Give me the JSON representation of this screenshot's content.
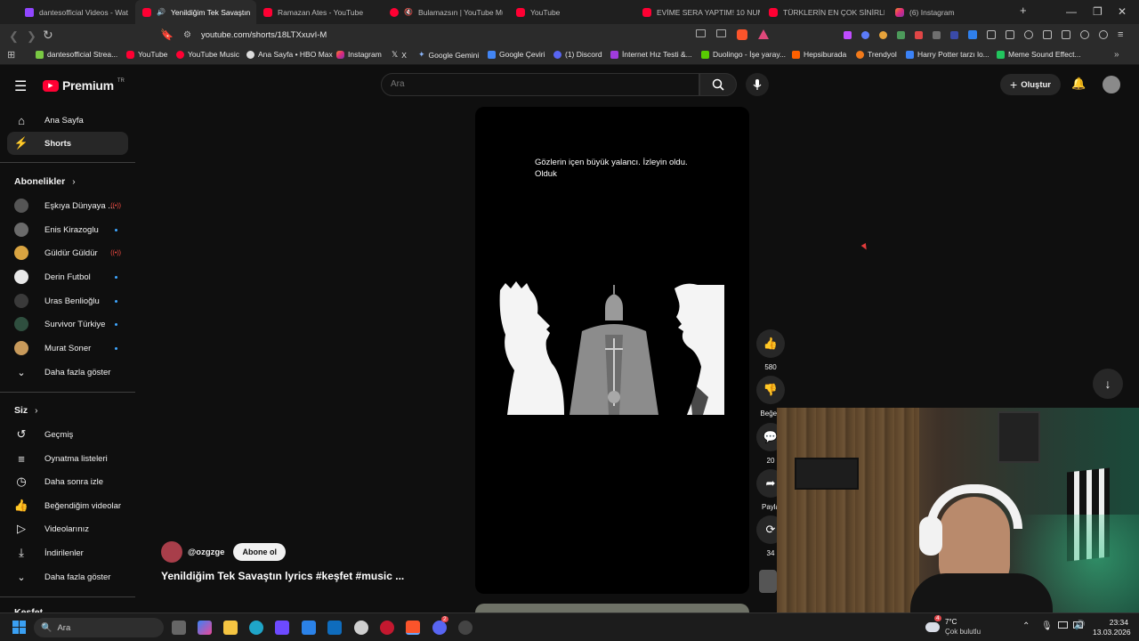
{
  "browser": {
    "tabs": [
      {
        "title": "dantesofficial Videos - Wat",
        "icon": "twitch-icon",
        "active": false
      },
      {
        "title": "Yenildiğim Tek Savaştın",
        "icon": "youtube-icon",
        "active": true
      },
      {
        "title": "Ramazan Ates - YouTube",
        "icon": "youtube-icon",
        "active": false
      },
      {
        "title": "Bulamazsın | YouTube Mu",
        "icon": "youtube-music-icon",
        "active": false
      },
      {
        "title": "YouTube",
        "icon": "youtube-icon",
        "active": false
      },
      {
        "title": "EVİME SERA YAPTIM! 10 NUM",
        "icon": "youtube-icon",
        "active": false
      },
      {
        "title": "TÜRKLERİN EN ÇOK SİNİRLENI",
        "icon": "youtube-icon",
        "active": false
      },
      {
        "title": "(6) Instagram",
        "icon": "instagram-icon",
        "active": false
      }
    ],
    "url": "youtube.com/shorts/18LTXxuvI-M",
    "bookmarks": [
      "dantesofficial Strea...",
      "YouTube",
      "YouTube Music",
      "Ana Sayfa • HBO Max",
      "Instagram",
      "X",
      "Google Gemini",
      "Google Çeviri",
      "(1) Discord",
      "İnternet Hız Testi &...",
      "Duolingo - İşe yaray...",
      "Hepsiburada",
      "Trendyol",
      "Harry Potter tarzı lo...",
      "Meme Sound Effect..."
    ]
  },
  "youtube": {
    "logo_text": "Premium",
    "logo_sup": "TR",
    "search_placeholder": "Ara",
    "create_label": "Oluştur",
    "sidebar": {
      "main": [
        {
          "label": "Ana Sayfa",
          "icon": "home-icon"
        },
        {
          "label": "Shorts",
          "icon": "shorts-icon",
          "active": true
        }
      ],
      "subscriptions_title": "Abonelikler",
      "subscriptions": [
        {
          "label": "Eşkıya Dünyaya ...",
          "status": "live",
          "color": "#555555"
        },
        {
          "label": "Enis Kirazoglu",
          "status": "new",
          "color": "#6b6b6b"
        },
        {
          "label": "Güldür Güldür",
          "status": "live",
          "color": "#d9a441"
        },
        {
          "label": "Derin Futbol",
          "status": "new",
          "color": "#e8e8e8"
        },
        {
          "label": "Uras Benlioğlu",
          "status": "new",
          "color": "#3a3a3a"
        },
        {
          "label": "Survivor Türkiye",
          "status": "new",
          "color": "#2f4f3f"
        },
        {
          "label": "Murat Soner",
          "status": "new",
          "color": "#c89a5b"
        }
      ],
      "show_more": "Daha fazla göster",
      "you_title": "Siz",
      "you_items": [
        {
          "label": "Geçmiş",
          "icon": "history-icon"
        },
        {
          "label": "Oynatma listeleri",
          "icon": "playlist-icon"
        },
        {
          "label": "Daha sonra izle",
          "icon": "clock-icon"
        },
        {
          "label": "Beğendiğim videolar",
          "icon": "thumbs-up-icon"
        },
        {
          "label": "Videolarınız",
          "icon": "video-icon"
        },
        {
          "label": "İndirilenler",
          "icon": "download-icon"
        }
      ],
      "show_more_2": "Daha fazla göster",
      "explore_title": "Keşfet"
    },
    "short": {
      "caption": "Gözlerin içen büyük yalancı. İzleyin oldu. Olduk",
      "channel": "@ozgzge",
      "subscribe": "Abone ol",
      "title": "Yenildiğim Tek Savaştın lyrics #keşfet #music ...",
      "likes": "580",
      "dislike_label": "Beğen",
      "comments": "20",
      "share_label": "Payla",
      "remix": "34"
    }
  },
  "taskbar": {
    "search_placeholder": "Ara",
    "weather_temp": "7°C",
    "weather_desc": "Çok bulutlu",
    "time": "23:34",
    "date": "13.03.2026",
    "notif_count": "4",
    "discord_badge": "2"
  }
}
